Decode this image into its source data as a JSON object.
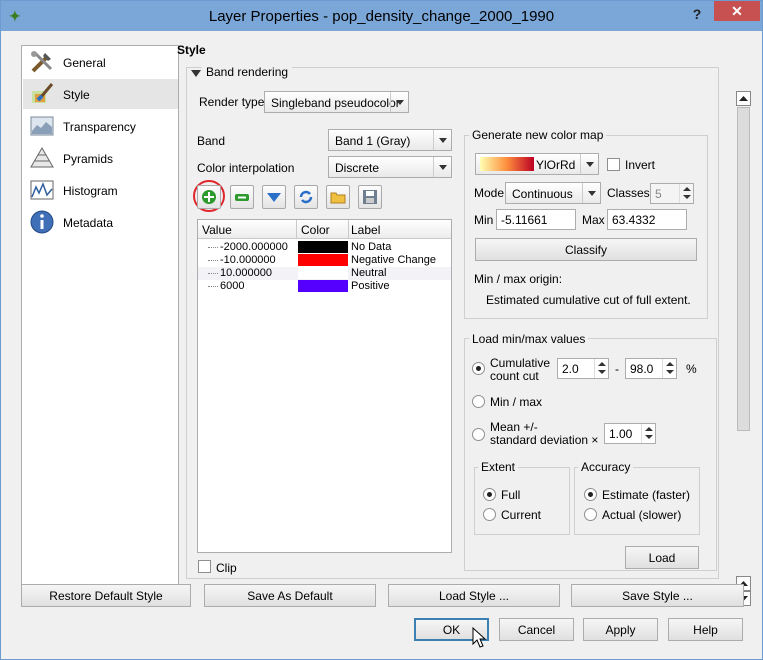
{
  "window": {
    "title": "Layer Properties - pop_density_change_2000_1990",
    "help": "?",
    "close": "✕"
  },
  "nav": {
    "items": [
      {
        "label": "General",
        "icon": "general-tools-icon"
      },
      {
        "label": "Style",
        "icon": "style-brush-icon",
        "selected": true
      },
      {
        "label": "Transparency",
        "icon": "transparency-icon"
      },
      {
        "label": "Pyramids",
        "icon": "pyramids-icon"
      },
      {
        "label": "Histogram",
        "icon": "histogram-icon"
      },
      {
        "label": "Metadata",
        "icon": "info-icon"
      }
    ]
  },
  "style": {
    "section_title": "Style",
    "group_title": "Band rendering",
    "render_type_label": "Render type",
    "render_type_value": "Singleband pseudocolor",
    "band_label": "Band",
    "band_value": "Band 1 (Gray)",
    "interp_label": "Color interpolation",
    "interp_value": "Discrete",
    "table": {
      "headers": [
        "Value",
        "Color",
        "Label"
      ],
      "rows": [
        {
          "value": "-2000.000000",
          "color": "#000000",
          "label": "No Data"
        },
        {
          "value": "-10.000000",
          "color": "#ff0000",
          "label": "Negative Change"
        },
        {
          "value": "10.000000",
          "color": "#ffffff",
          "label": "Neutral"
        },
        {
          "value": "6000",
          "color": "#5500ff",
          "label": "Positive"
        }
      ]
    },
    "clip_label": "Clip"
  },
  "colormap": {
    "title": "Generate new color map",
    "ramp_name": "YlOrRd",
    "invert_label": "Invert",
    "mode_label": "Mode",
    "mode_value": "Continuous",
    "classes_label": "Classes",
    "classes_value": "5",
    "min_label": "Min",
    "min_value": "-5.11661",
    "max_label": "Max",
    "max_value": "63.4332",
    "classify_label": "Classify",
    "origin_label": "Min / max origin:",
    "origin_text": "Estimated cumulative cut of full extent."
  },
  "minmax": {
    "title": "Load min/max values",
    "cumulative_label": "Cumulative\ncount cut",
    "cum_low": "2.0",
    "dash": "-",
    "cum_high": "98.0",
    "percent": "%",
    "minmax_label": "Min / max",
    "meanstd_label": "Mean +/-\nstandard deviation ×",
    "std_value": "1.00",
    "extent_title": "Extent",
    "extent_full": "Full",
    "extent_current": "Current",
    "accuracy_title": "Accuracy",
    "accuracy_estimate": "Estimate (faster)",
    "accuracy_actual": "Actual (slower)",
    "load_label": "Load"
  },
  "bottom": {
    "restore": "Restore Default Style",
    "save_default": "Save As Default",
    "load_style": "Load Style ...",
    "save_style": "Save Style ...",
    "ok": "OK",
    "cancel": "Cancel",
    "apply": "Apply",
    "help": "Help"
  }
}
